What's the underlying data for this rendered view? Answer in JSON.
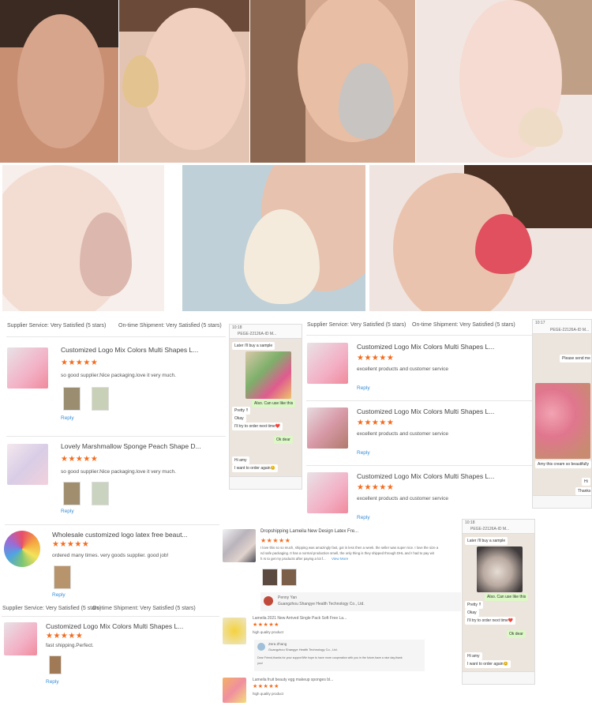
{
  "colors": {
    "star": "#f26b1d",
    "reply": "#3a8fd6",
    "chat_bg": "#ece5dd",
    "chat_me": "#dcf8c6"
  },
  "review_panel_1": {
    "supplier_label": "Supplier Service: Very Satisfied  (5 stars)",
    "shipment_label": "On-time Shipment: Very Satisfied   (5 stars)",
    "cards": [
      {
        "title": "Customized Logo Mix Colors Multi Shapes L...",
        "stars": "★★★★★",
        "comment": "so good supplier.Nice packaging.love it very much.",
        "reply": "Reply"
      },
      {
        "title": "Lovely Marshmallow Sponge Peach Shape D...",
        "stars": "★★★★★",
        "comment": "so good supplier.Nice packaging.love it very much.",
        "reply": "Reply"
      }
    ]
  },
  "review_panel_2": {
    "supplier_label": "Supplier Service: Very Satisfied  (5 stars)",
    "shipment_label": "On-time Shipment: Very Satisfied  (5 stars)",
    "cards": [
      {
        "title": "Customized Logo Mix Colors Multi Shapes L...",
        "stars": "★★★★★",
        "comment": "excellent products and customer service",
        "reply": "Reply"
      },
      {
        "title": "Customized Logo Mix Colors Multi Shapes L...",
        "stars": "★★★★★",
        "comment": "excellent products and customer service",
        "reply": "Reply"
      },
      {
        "title": "Customized Logo Mix Colors Multi Shapes L...",
        "stars": "★★★★★",
        "comment": "excellent products and customer service",
        "reply": "Reply"
      }
    ]
  },
  "review_panel_3": {
    "title": "Wholesale customized logo latex free beaut...",
    "stars": "★★★★★",
    "comment": "ordered many times. very goods supplier. good job!",
    "reply": "Reply"
  },
  "review_panel_4": {
    "supplier_label": "Supplier Service: Very Satisfied   (5 stars)",
    "shipment_label": "On-time Shipment: Very Satisfied   (5 stars)",
    "title": "Customized Logo Mix Colors Multi Shapes L...",
    "stars": "★★★★★",
    "comment": "fast shipping.Perfect.",
    "reply": "Reply"
  },
  "review_panel_5": {
    "title": "Dropshipping Lameila New Design Latex Fre...",
    "stars": "★★★★★",
    "body_1": "I love this so so much, shipping was amazingly fast, got in less then a week. the seller was super nice. I love the size a",
    "body_2": "nd safe packaging. It has a normal production smell, the only thing is they shipped through DHL and I had to pay wit",
    "body_3": "h rs to get my products after paying a lot f...",
    "view_more": "View More",
    "replier_name": "Penny Yan",
    "replier_company": "Guangzhou Shangye Health Technology Co., Ltd."
  },
  "review_panel_6": {
    "title": "Lameila 2021 New Arrived Single Pack Soft Free La...",
    "stars": "★★★★★",
    "quality": "high quality product",
    "replier_name": "Zera Zhang",
    "replier_company": "Guangzhou Shangye Health Technology Co., Ltd.",
    "reply_text_1": "Dear Friend,thanks for your support!We hope to have more cooperation with you in the future,have a nice day,thank",
    "reply_text_2": "you!"
  },
  "review_panel_7": {
    "title": "Lameila fruit beauty egg makeup sponges bl...",
    "stars": "★★★★★",
    "quality": "high quality product"
  },
  "chat_1": {
    "time": "10:18",
    "contact": "PEGE-22126A-ID M...",
    "msg_1": "Later i'll buy a sample",
    "msg_2": "Also. Can use like this",
    "msg_3": "Pretty !!",
    "msg_4": "Okay",
    "msg_5": "I'll try to order next time❤️",
    "msg_6": "Ok dear",
    "msg_7": "Hi amy",
    "msg_8": "I want to order again😊"
  },
  "chat_2": {
    "time": "10:17",
    "contact": "PEGE-22126A-ID M...",
    "msg_1": "Please send me",
    "msg_2": "Amy this cream so beautifully",
    "msg_3": "Hi",
    "msg_4": "Thanks"
  },
  "chat_3": {
    "time": "10:18",
    "contact": "PEGE-22126A-ID M...",
    "msg_1": "Later i'll buy a sample",
    "msg_2": "Also. Can use like this",
    "msg_3": "Pretty !!",
    "msg_4": "Okay",
    "msg_5": "I'll try to order next time❤️",
    "msg_6": "Ok dear",
    "msg_7": "Hi amy",
    "msg_8": "I want to order again😊"
  }
}
